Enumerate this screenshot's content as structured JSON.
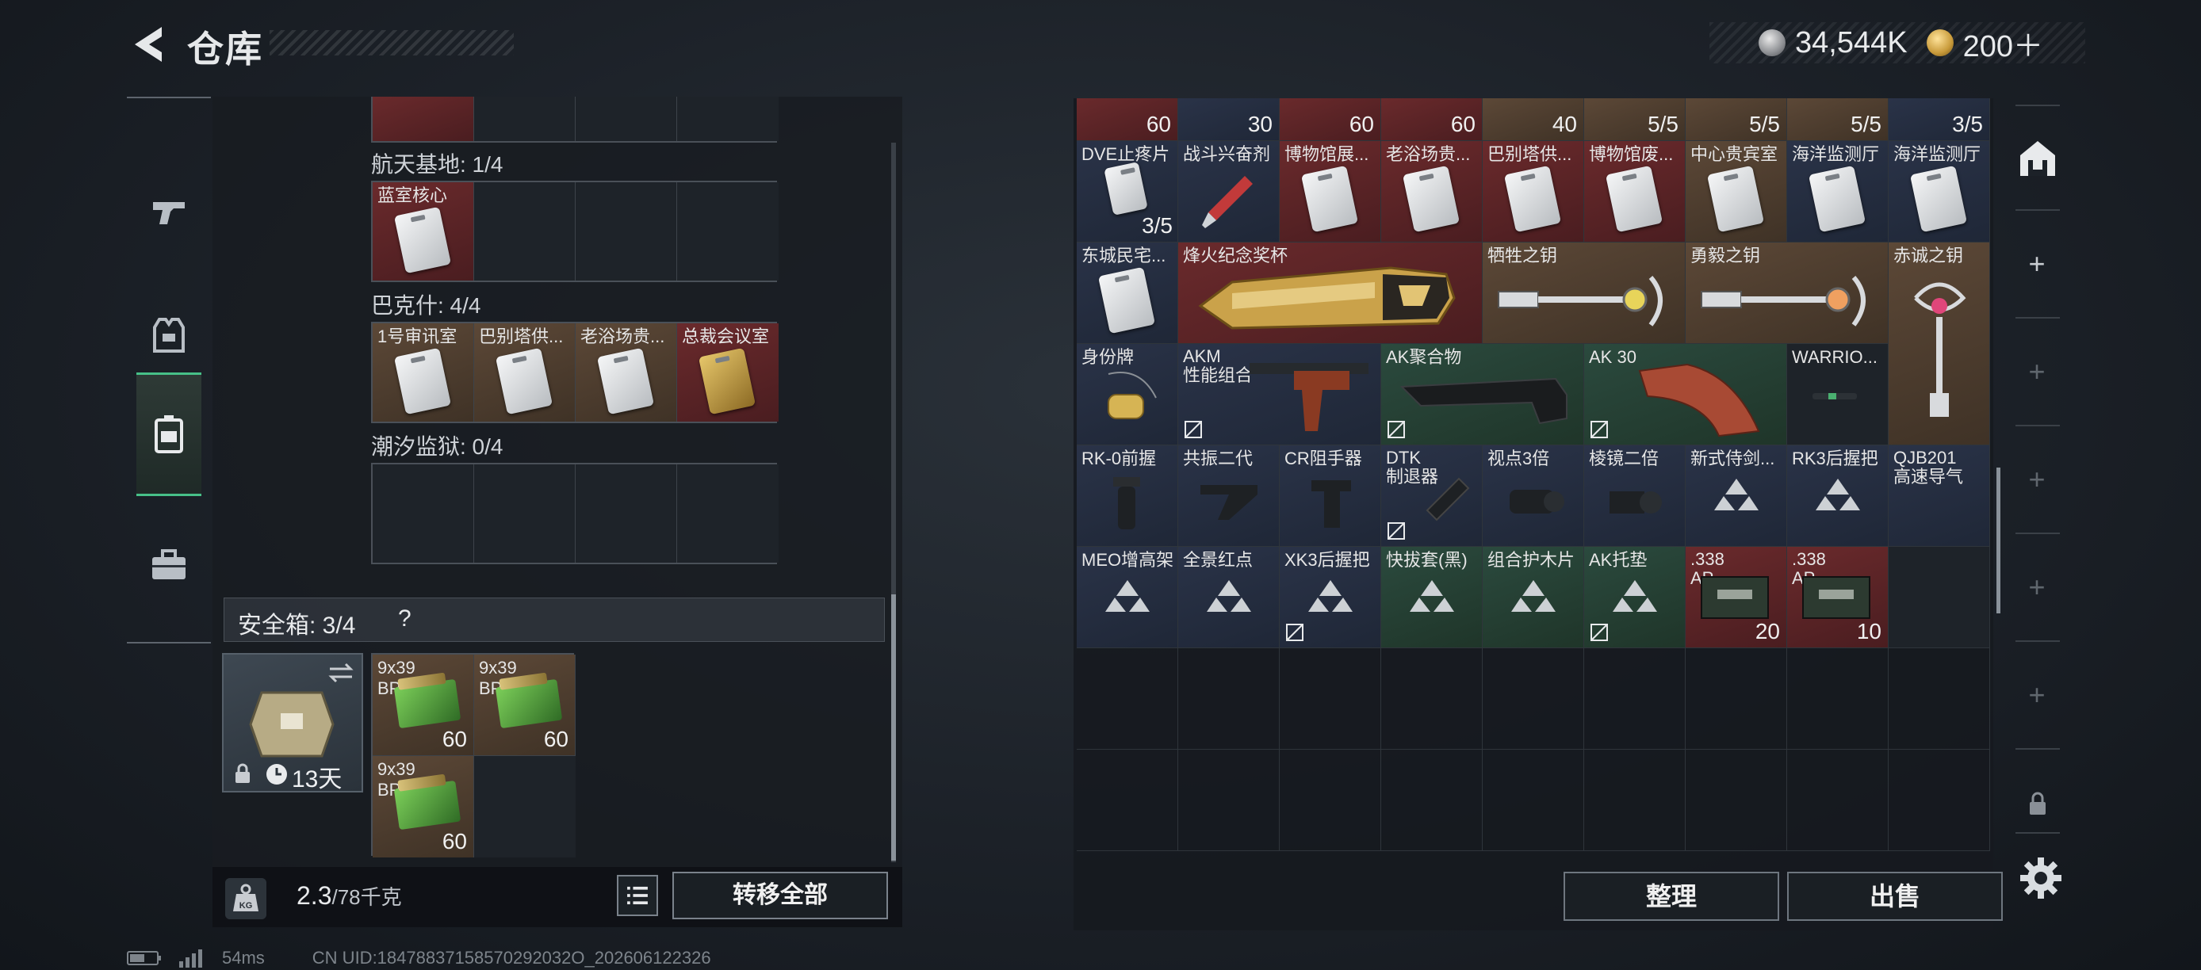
{
  "header": {
    "title": "仓库",
    "currency": [
      {
        "icon": "silver-coin-icon",
        "value": "34,544K"
      },
      {
        "icon": "gold-coin-icon",
        "value": "200＋"
      }
    ]
  },
  "left_tabs": [
    {
      "icon": "pistol-icon",
      "active": false
    },
    {
      "icon": "armor-vest-icon",
      "active": false
    },
    {
      "icon": "keycard-icon",
      "active": true
    },
    {
      "icon": "toolbox-icon",
      "active": false
    }
  ],
  "key_sections": [
    {
      "label": "航天基地: 1/4",
      "items": [
        {
          "name": "蓝室核心",
          "color": "red"
        },
        {},
        {},
        {}
      ]
    },
    {
      "label": "巴克什: 4/4",
      "items": [
        {
          "name": "1号审讯室",
          "color": "brown"
        },
        {
          "name": "巴别塔供...",
          "color": "brown"
        },
        {
          "name": "老浴场贵...",
          "color": "brown"
        },
        {
          "name": "总裁会议室",
          "color": "red",
          "gold": true
        }
      ]
    },
    {
      "label": "潮汐监狱: 0/4",
      "items": [
        {},
        {},
        {},
        {}
      ]
    }
  ],
  "safe_box": {
    "title": "安全箱: 3/4",
    "help": "?",
    "timer": "13天",
    "items": [
      {
        "name": "9x39 BP",
        "count": "60"
      },
      {
        "name": "9x39 BP",
        "count": "60"
      },
      {
        "name": "9x39 BP",
        "count": "60"
      }
    ]
  },
  "bottom_left": {
    "weight": "2.3",
    "weight_max": "/78千克",
    "transfer_all": "转移全部"
  },
  "stash_top_counts": [
    "60",
    "30",
    "60",
    "60",
    "40",
    "5/5",
    "5/5",
    "5/5",
    "3/5"
  ],
  "stash": {
    "row1": [
      {
        "name": "DVE止疼片",
        "count": "3/5",
        "color": "blue"
      },
      {
        "name": "战斗兴奋剂",
        "color": "blue"
      },
      {
        "name": "博物馆展...",
        "color": "red"
      },
      {
        "name": "老浴场贵...",
        "color": "red"
      },
      {
        "name": "巴别塔供...",
        "color": "red"
      },
      {
        "name": "博物馆废...",
        "color": "red"
      },
      {
        "name": "中心贵宾室",
        "color": "brown"
      },
      {
        "name": "海洋监测厅",
        "color": "blue"
      },
      {
        "name": "海洋监测厅",
        "color": "blue"
      }
    ],
    "row2": [
      {
        "name": "东城民宅...",
        "color": "blue"
      },
      {
        "name": "烽火纪念奖杯",
        "color": "red"
      },
      {
        "name": "牺牲之钥",
        "color": "brown"
      },
      {
        "name": "勇毅之钥",
        "color": "brown"
      },
      {
        "name": "赤诚之钥",
        "color": "brown"
      }
    ],
    "row3": [
      {
        "name": "身份牌",
        "color": "blue"
      },
      {
        "name": "AKM\n性能组合",
        "color": "blue"
      },
      {
        "name": "AK聚合物",
        "color": "green"
      },
      {
        "name": "AK 30",
        "color": "green"
      },
      {
        "name": "WARRIO...",
        "color": "dark"
      }
    ],
    "row4": [
      {
        "name": "RK-0前握",
        "color": "blue"
      },
      {
        "name": "共振二代",
        "color": "blue"
      },
      {
        "name": "CR阻手器",
        "color": "blue"
      },
      {
        "name": "DTK\n制退器",
        "color": "blue"
      },
      {
        "name": "视点3倍",
        "color": "blue"
      },
      {
        "name": "棱镜二倍",
        "color": "blue"
      },
      {
        "name": "新式侍剑...",
        "color": "blue"
      },
      {
        "name": "RK3后握把",
        "color": "blue"
      },
      {
        "name": "QJB201\n高速导气",
        "color": "blue"
      }
    ],
    "row5": [
      {
        "name": "MEO增高架",
        "color": "blue"
      },
      {
        "name": "全景红点",
        "color": "blue"
      },
      {
        "name": "XK3后握把",
        "color": "blue"
      },
      {
        "name": "快拔套(黑)",
        "color": "green"
      },
      {
        "name": "组合护木片",
        "color": "green"
      },
      {
        "name": "AK托垫",
        "color": "green"
      },
      {
        "name": ".338\nAP",
        "count": "20",
        "color": "red"
      },
      {
        "name": ".338\nAP",
        "count": "10",
        "color": "red"
      }
    ]
  },
  "actions": {
    "sort": "整理",
    "sell": "出售"
  },
  "footer": {
    "ping": "54ms",
    "uid": "CN UID:18478837158570292032O_202606122326"
  }
}
